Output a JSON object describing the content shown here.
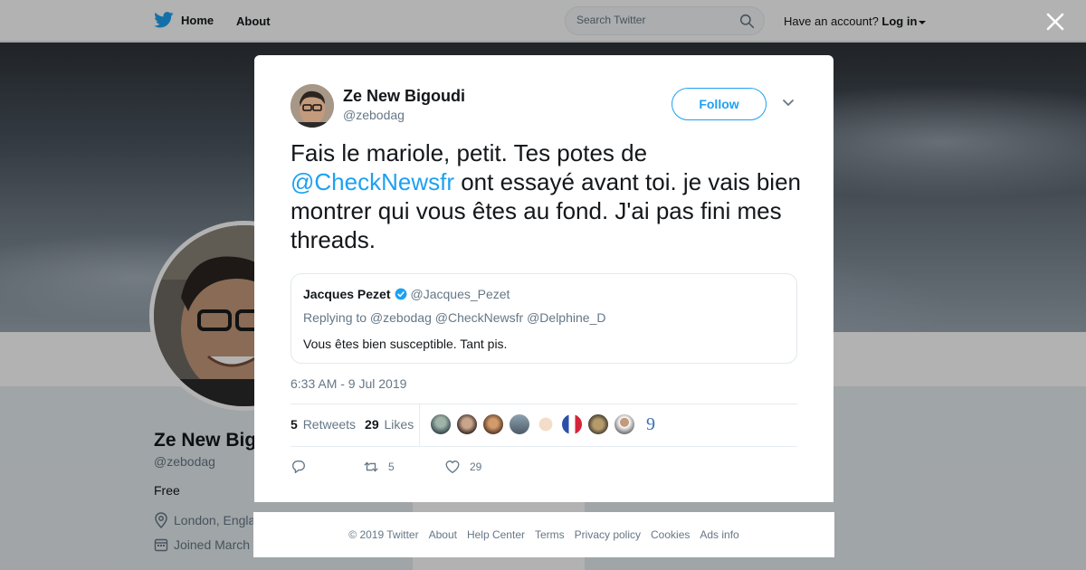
{
  "topbar": {
    "home_label": "Home",
    "about_label": "About",
    "search_placeholder": "Search Twitter",
    "account_prompt": "Have an account?",
    "login_label": "Log in"
  },
  "profile": {
    "name": "Ze New Bigoudi",
    "handle": "@zebodag",
    "bio": "Free",
    "location": "London, England",
    "joined": "Joined March"
  },
  "tweet": {
    "author_name": "Ze New Bigoudi",
    "author_handle": "@zebodag",
    "follow_label": "Follow",
    "text_part1": "Fais le mariole, petit. Tes potes de ",
    "mention": "@CheckNewsfr",
    "text_part2": " ont essayé avant toi. je vais bien montrer qui vous êtes au fond. J'ai pas fini mes threads.",
    "timestamp": "6:33 AM - 9 Jul 2019",
    "retweet_count": "5",
    "retweet_label": "Retweets",
    "like_count": "29",
    "like_label": "Likes",
    "action_retweet_count": "5",
    "action_like_count": "29"
  },
  "quoted": {
    "name": "Jacques Pezet",
    "handle": "@Jacques_Pezet",
    "reply_to": "Replying to @zebodag @CheckNewsfr @Delphine_D",
    "text": "Vous êtes bien susceptible. Tant pis."
  },
  "footer": {
    "items": [
      "© 2019 Twitter",
      "About",
      "Help Center",
      "Terms",
      "Privacy policy",
      "Cookies",
      "Ads info"
    ]
  },
  "colors": {
    "accent": "#1da1f2",
    "text": "#14171a",
    "muted": "#657786"
  },
  "icons": [
    "twitter-bird-icon",
    "search-icon",
    "close-icon",
    "chevron-down-icon",
    "verified-badge-icon",
    "reply-icon",
    "retweet-icon",
    "heart-icon",
    "location-icon",
    "calendar-icon"
  ]
}
